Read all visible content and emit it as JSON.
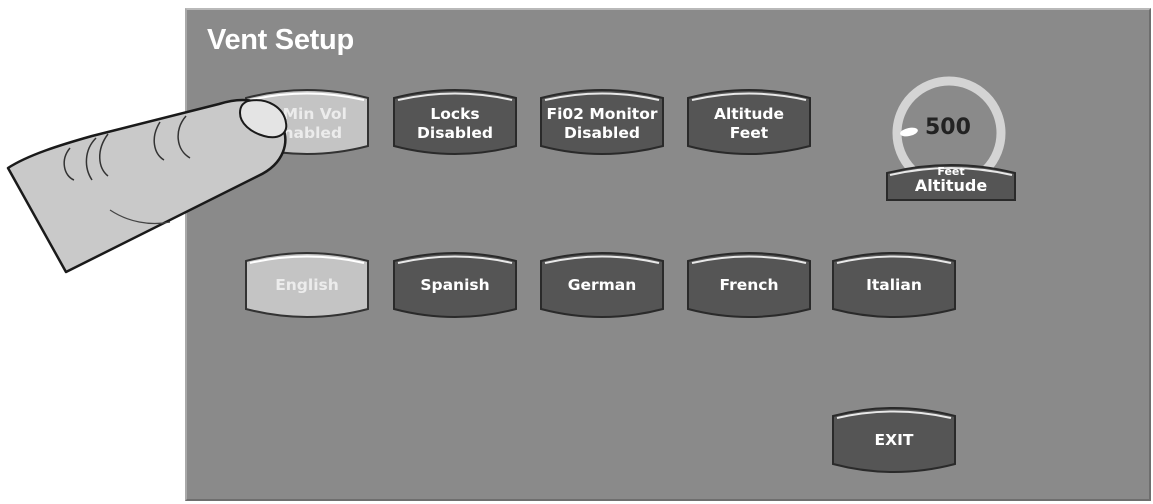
{
  "screen": {
    "title": "Vent Setup"
  },
  "buttons": [
    {
      "id": "min-vol",
      "lines": [
        "y Min Vol",
        "Enabled"
      ],
      "active": true
    },
    {
      "id": "locks",
      "lines": [
        "Locks",
        "Disabled"
      ],
      "active": false
    },
    {
      "id": "fio2-monitor",
      "lines": [
        "Fi02 Monitor",
        "Disabled"
      ],
      "active": false
    },
    {
      "id": "altitude-units",
      "lines": [
        "Altitude",
        "Feet"
      ],
      "active": false
    }
  ],
  "languages": [
    {
      "label": "English",
      "active": true
    },
    {
      "label": "Spanish",
      "active": false
    },
    {
      "label": "German",
      "active": false
    },
    {
      "label": "French",
      "active": false
    },
    {
      "label": "Italian",
      "active": false
    }
  ],
  "altitude": {
    "value": "500",
    "unit": "Feet",
    "label": "Altitude"
  },
  "exit": {
    "label": "EXIT"
  },
  "colors": {
    "panel": "#8a8a8a",
    "button": "#555555",
    "button_active": "#c2c2c2",
    "text": "#ffffff"
  }
}
